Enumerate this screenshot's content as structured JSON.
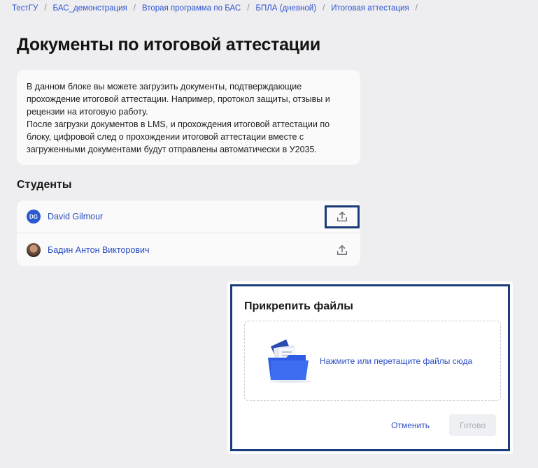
{
  "breadcrumb": [
    "ТестГУ",
    "БАС_демонстрация",
    "Вторая программа по БАС",
    "БПЛА (дневной)",
    "Итоговая аттестация"
  ],
  "breadcrumb_separator": "/",
  "page_title": "Документы по итоговой аттестации",
  "info": {
    "paragraph1": "В данном блоке вы можете загрузить документы, подтверждающие прохождение итоговой аттестации. Например, протокол защиты, отзывы и рецензии на итоговую работу.",
    "paragraph2": "После загрузки документов в LMS, и прохождения итоговой аттестации по блоку, цифровой след о прохождении итоговой аттестации вместе с загруженными документами будут отправлены автоматически в У2035."
  },
  "students_section_title": "Студенты",
  "students": [
    {
      "name": "David Gilmour",
      "initials": "DG",
      "avatar": "initials",
      "upload_icon": "upload-icon"
    },
    {
      "name": "Бадин Антон Викторович",
      "initials": "",
      "avatar": "photo",
      "upload_icon": "upload-icon"
    }
  ],
  "modal": {
    "title": "Прикрепить файлы",
    "dropzone_text": "Нажмите или перетащите файлы сюда",
    "dropzone_icon": "folder-icon",
    "cancel_label": "Отменить",
    "done_label": "Готово"
  },
  "colors": {
    "accent": "#2c4fc4",
    "highlight": "#1b3c7c",
    "background": "#f3f3f5"
  }
}
